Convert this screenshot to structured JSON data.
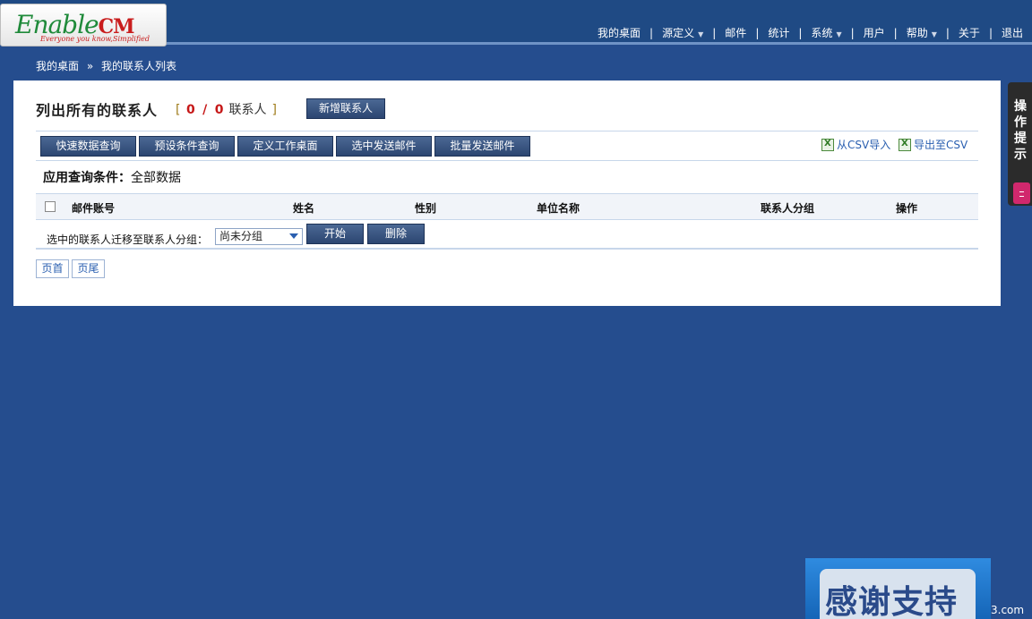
{
  "logo": {
    "brand": "Enable",
    "brand_suffix": "CM",
    "tagline": "Everyone you know,Simplified"
  },
  "nav": {
    "items": [
      {
        "label": "我的桌面",
        "has_menu": false
      },
      {
        "label": "源定义",
        "has_menu": true
      },
      {
        "label": "邮件",
        "has_menu": false
      },
      {
        "label": "统计",
        "has_menu": false
      },
      {
        "label": "系统",
        "has_menu": true
      },
      {
        "label": "用户",
        "has_menu": false
      },
      {
        "label": "帮助",
        "has_menu": true
      },
      {
        "label": "关于",
        "has_menu": false
      },
      {
        "label": "退出",
        "has_menu": false
      }
    ],
    "separator": "|"
  },
  "breadcrumb": {
    "home": "我的桌面",
    "arrow": "»",
    "current": "我的联系人列表"
  },
  "page": {
    "title": "列出所有的联系人",
    "count_open": "[",
    "count_shown": "0",
    "count_slash": "/",
    "count_total": "0",
    "count_unit": "联系人",
    "count_close": "]",
    "add_button": "新增联系人"
  },
  "toolbar": {
    "buttons": [
      "快速数据查询",
      "预设条件查询",
      "定义工作桌面",
      "选中发送邮件",
      "批量发送邮件"
    ],
    "import_csv": "从CSV导入",
    "export_csv": "导出至CSV"
  },
  "query_condition": {
    "label": "应用查询条件：",
    "value": "全部数据"
  },
  "table": {
    "columns": [
      "邮件账号",
      "姓名",
      "性别",
      "单位名称",
      "联系人分组",
      "操作"
    ]
  },
  "move_row": {
    "label": "选中的联系人迁移至联系人分组：",
    "select_value": "尚未分组",
    "start_button": "开始",
    "delete_button": "删除"
  },
  "pager": {
    "first": "页首",
    "last": "页尾"
  },
  "side_tab": {
    "label": "操作提示"
  },
  "thanks_badge": {
    "text": "感谢支持"
  },
  "watermark": "3.com",
  "colors": {
    "background": "#254d8e",
    "header": "#1f4a84",
    "button": "#2c4671",
    "accent_red": "#c61818"
  }
}
